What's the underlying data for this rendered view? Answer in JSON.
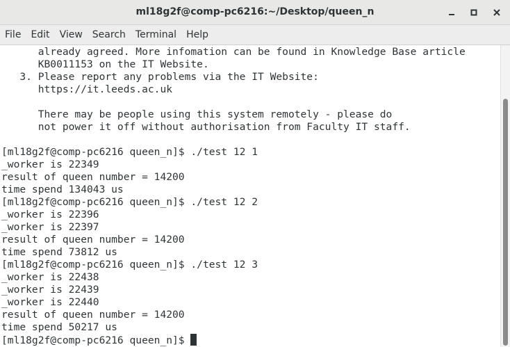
{
  "window": {
    "title": "ml18g2f@comp-pc6216:~/Desktop/queen_n",
    "controls": [
      "minimize-icon",
      "maximize-icon",
      "close-icon"
    ]
  },
  "menu": {
    "file": "File",
    "edit": "Edit",
    "view": "View",
    "search": "Search",
    "terminal": "Terminal",
    "help": "Help"
  },
  "terminal": {
    "lines": [
      "      already agreed. More infomation can be found in Knowledge Base article",
      "      KB0011153 on the IT Website.",
      "   3. Please report any problems via the IT Website:",
      "      https://it.leeds.ac.uk",
      "",
      "      There may be people using this system remotely - please do",
      "      not power it off without authorisation from Faculty IT staff.",
      "",
      "[ml18g2f@comp-pc6216 queen_n]$ ./test 12 1",
      "_worker is 22349",
      "result of queen number = 14200",
      "time spend 134043 us",
      "[ml18g2f@comp-pc6216 queen_n]$ ./test 12 2",
      "_worker is 22396",
      "_worker is 22397",
      "result of queen number = 14200",
      "time spend 73812 us",
      "[ml18g2f@comp-pc6216 queen_n]$ ./test 12 3",
      "_worker is 22438",
      "_worker is 22439",
      "_worker is 22440",
      "result of queen number = 14200",
      "time spend 50217 us"
    ],
    "prompt": "[ml18g2f@comp-pc6216 queen_n]$ "
  },
  "colors": {
    "titlebar_bg": "#e8e8e7",
    "menubar_bg": "#ededed",
    "terminal_bg": "#ffffff",
    "terminal_fg": "#2e3436",
    "scroll_thumb": "#8a8c89"
  }
}
